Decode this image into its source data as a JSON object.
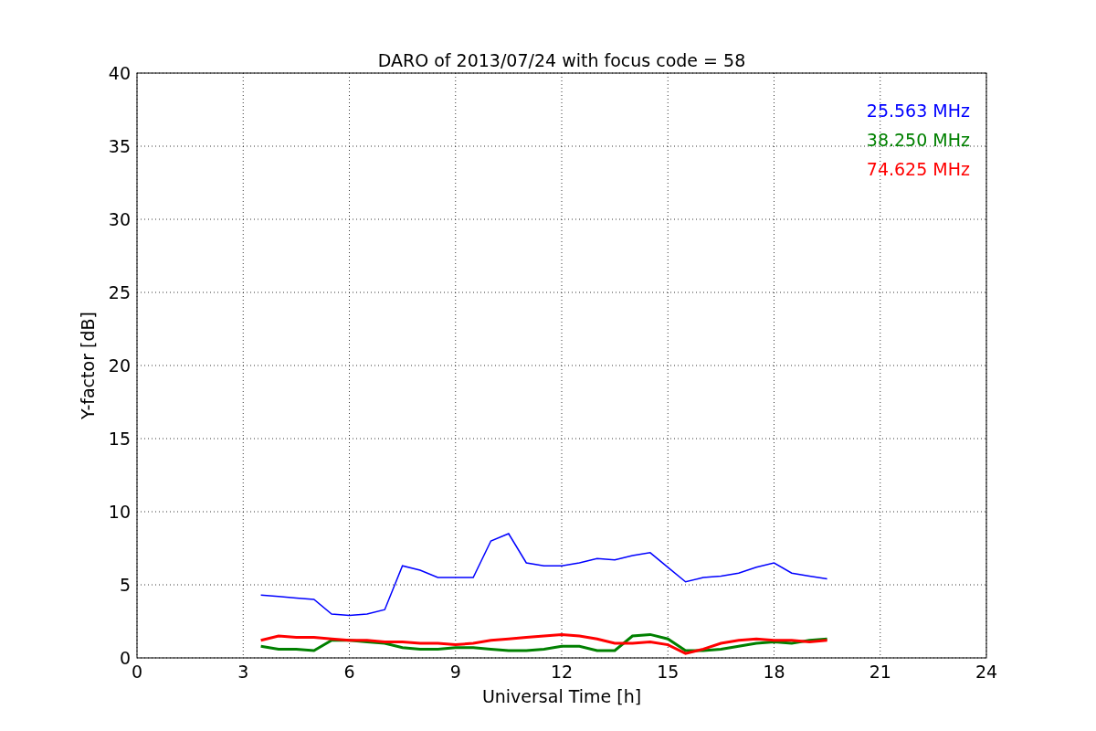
{
  "figure": {
    "chart_data": {
      "type": "line",
      "title": "DARO of 2013/07/24 with focus code = 58",
      "xlabel": "Universal Time [h]",
      "ylabel": "Y-factor [dB]",
      "x": [
        3.5,
        4,
        4.5,
        5,
        5.5,
        6,
        6.5,
        7,
        7.5,
        8,
        8.5,
        9,
        9.5,
        10,
        10.5,
        11,
        11.5,
        12,
        12.5,
        13,
        13.5,
        14,
        14.5,
        15,
        15.5,
        16,
        16.5,
        17,
        17.5,
        18,
        18.5,
        19,
        19.5
      ],
      "series": [
        {
          "name": "25.563 MHz",
          "color": "#0000ff",
          "values": [
            4.3,
            4.2,
            4.1,
            4.0,
            3.0,
            2.9,
            3.0,
            3.3,
            6.3,
            6.0,
            5.5,
            5.5,
            5.5,
            8.0,
            8.5,
            6.5,
            6.3,
            6.3,
            6.5,
            6.8,
            6.7,
            7.0,
            7.2,
            6.2,
            5.2,
            5.5,
            5.6,
            5.8,
            6.2,
            6.5,
            5.8,
            5.6,
            5.4
          ]
        },
        {
          "name": "38.250 MHz",
          "color": "#008000",
          "values": [
            0.8,
            0.6,
            0.6,
            0.5,
            1.2,
            1.2,
            1.1,
            1.0,
            0.7,
            0.6,
            0.6,
            0.7,
            0.7,
            0.6,
            0.5,
            0.5,
            0.6,
            0.8,
            0.8,
            0.5,
            0.5,
            1.5,
            1.6,
            1.3,
            0.5,
            0.5,
            0.6,
            0.8,
            1.0,
            1.1,
            1.0,
            1.2,
            1.3
          ]
        },
        {
          "name": "74.625 MHz",
          "color": "#ff0000",
          "values": [
            1.2,
            1.5,
            1.4,
            1.4,
            1.3,
            1.2,
            1.2,
            1.1,
            1.1,
            1.0,
            1.0,
            0.9,
            1.0,
            1.2,
            1.3,
            1.4,
            1.5,
            1.6,
            1.5,
            1.3,
            1.0,
            1.0,
            1.1,
            0.9,
            0.3,
            0.6,
            1.0,
            1.2,
            1.3,
            1.2,
            1.2,
            1.1,
            1.2
          ]
        }
      ],
      "grid": true,
      "xlim": [
        0,
        24
      ],
      "ylim": [
        0,
        40
      ],
      "xticks": [
        0,
        3,
        6,
        9,
        12,
        15,
        18,
        21,
        24
      ],
      "yticks": [
        0,
        5,
        10,
        15,
        20,
        25,
        30,
        35,
        40
      ]
    }
  }
}
